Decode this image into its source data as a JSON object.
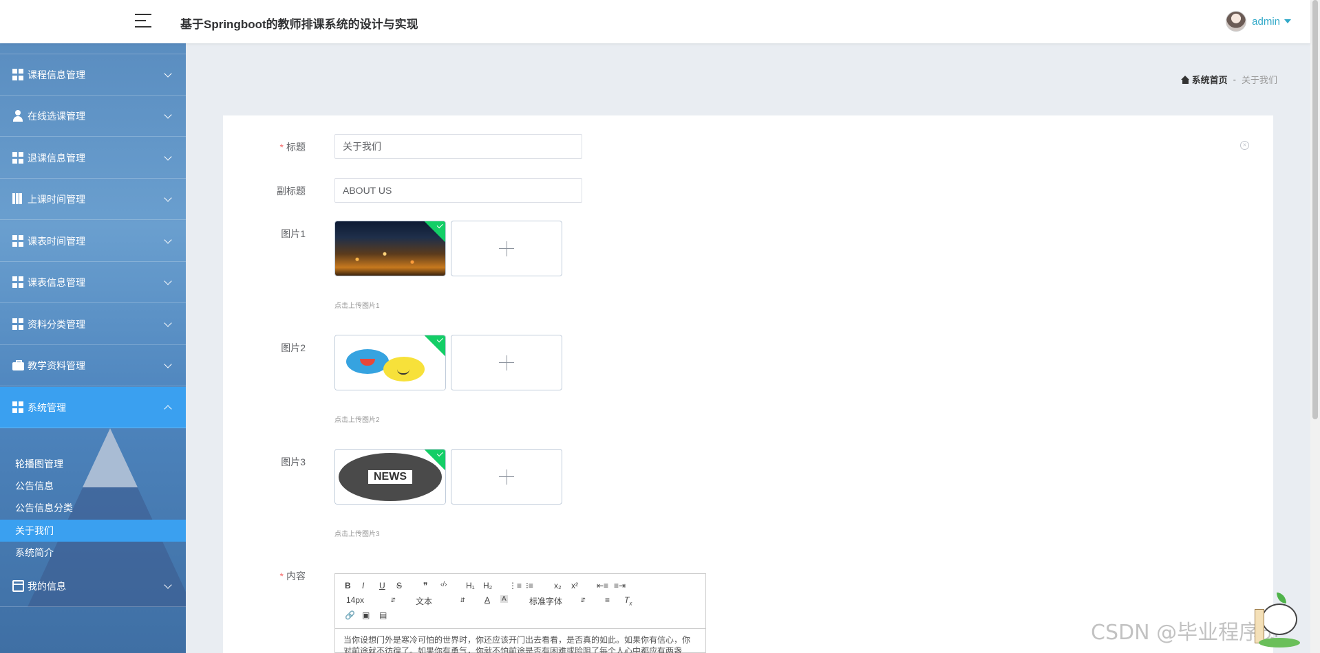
{
  "header": {
    "app_title": "基于Springboot的教师排课系统的设计与实现",
    "user_name": "admin"
  },
  "sidebar": {
    "items": [
      {
        "label": "课程信息管理",
        "icon": "grid-icon"
      },
      {
        "label": "在线选课管理",
        "icon": "person-icon"
      },
      {
        "label": "退课信息管理",
        "icon": "grid-icon"
      },
      {
        "label": "上课时间管理",
        "icon": "book-icon"
      },
      {
        "label": "课表时间管理",
        "icon": "grid-icon"
      },
      {
        "label": "课表信息管理",
        "icon": "grid-icon"
      },
      {
        "label": "资料分类管理",
        "icon": "grid-icon"
      },
      {
        "label": "教学资料管理",
        "icon": "briefcase-icon"
      },
      {
        "label": "系统管理",
        "icon": "grid-icon"
      },
      {
        "label": "我的信息",
        "icon": "card-icon"
      }
    ],
    "sub_items": [
      "轮播图管理",
      "公告信息",
      "公告信息分类",
      "关于我们",
      "系统简介"
    ]
  },
  "breadcrumb": {
    "home": "系统首页",
    "separator": "-",
    "current": "关于我们"
  },
  "form": {
    "title_label": "标题",
    "title_value": "关于我们",
    "subtitle_label": "副标题",
    "subtitle_value": "ABOUT US",
    "pic1_label": "图片1",
    "pic1_hint": "点击上传图片1",
    "pic2_label": "图片2",
    "pic2_hint": "点击上传图片2",
    "pic3_label": "图片3",
    "pic3_hint": "点击上传图片3",
    "content_label": "内容",
    "news_text": "NEWS"
  },
  "editor": {
    "bold": "B",
    "italic": "I",
    "underline": "U",
    "strike": "S",
    "quote": "❞",
    "code": "‹/›",
    "h1": "H₁",
    "h2": "H₂",
    "ol": "⋮≡",
    "ul": "⁝≡",
    "sub": "x₂",
    "sup": "x²",
    "outdent": "⇤≡",
    "indent": "≡⇥",
    "font_size": "14px",
    "text_type": "文本",
    "font_family": "标准字体",
    "content_text": "当你设想门外是寒冷可怕的世界时，你还应该开门出去看看，是否真的如此。如果你有信心，你对前途就不彷徨了。如果你有勇气，你就不怕前途是否有困难或险阻了每个人心中都应有两盏灯。"
  },
  "watermark": "CSDN @毕业程序员",
  "colors": {
    "accent": "#3aa0f0",
    "success_badge": "#13ce66",
    "required": "#f56c6c",
    "user": "#30a8c8"
  }
}
